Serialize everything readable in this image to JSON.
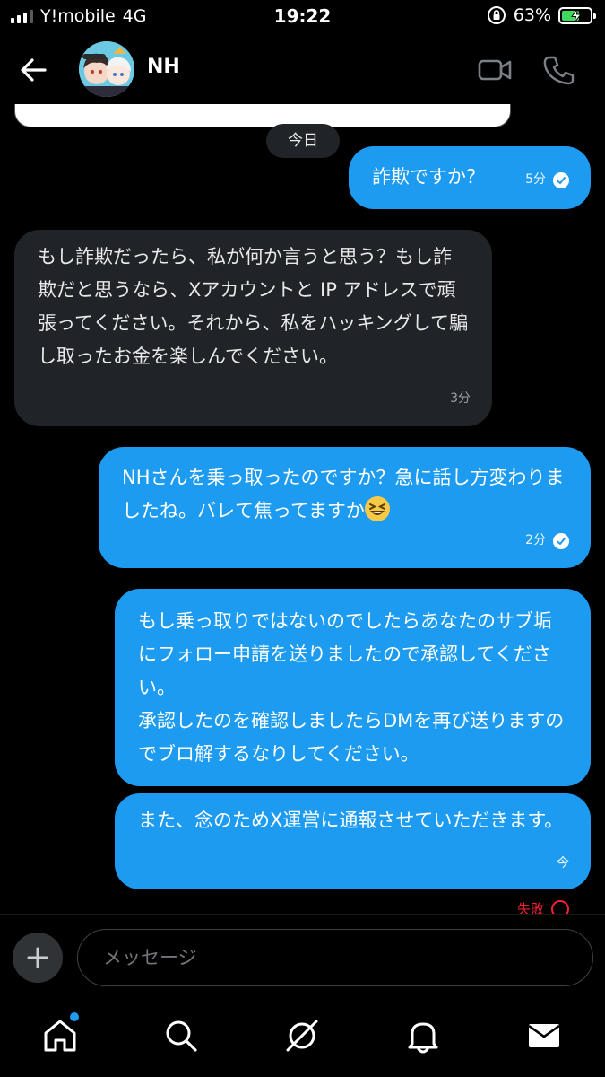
{
  "status_bar": {
    "carrier": "Y!mobile",
    "network": "4G",
    "time": "19:22",
    "battery": "63%",
    "battery_level": 0.63
  },
  "header": {
    "contact_name": "NH"
  },
  "date_separator": "今日",
  "messages": [
    {
      "side": "out",
      "text": "詐欺ですか？",
      "time": "5分",
      "status": "read"
    },
    {
      "side": "in",
      "text": "もし詐欺だったら、私が何か言うと思う？もし詐欺だと思うなら、Xアカウントと IP アドレスで頑張ってください。それから、私をハッキングして騙し取ったお金を楽しんでください。",
      "time": "3分"
    },
    {
      "side": "out",
      "text": "NHさんを乗っ取ったのですか？急に話し方変わりましたね。バレて焦ってますか",
      "time": "2分",
      "status": "read",
      "emoji": "grinning-squinting-face"
    },
    {
      "side": "out",
      "text": "もし乗っ取りではないのでしたらあなたのサブ垢にフォロー申請を送りましたので承認してください。\n承認したのを確認しましたらDMを再び送りますのでブロ解するなりしてください。"
    },
    {
      "side": "out",
      "text": "また、念のためX運営に通報させていただきます。",
      "time": "今"
    }
  ],
  "send_failed_label": "失敗",
  "composer": {
    "placeholder": "メッセージ"
  },
  "colors": {
    "accent": "#1d9bf0",
    "incoming_bubble": "#202327",
    "error": "#f4212e"
  }
}
